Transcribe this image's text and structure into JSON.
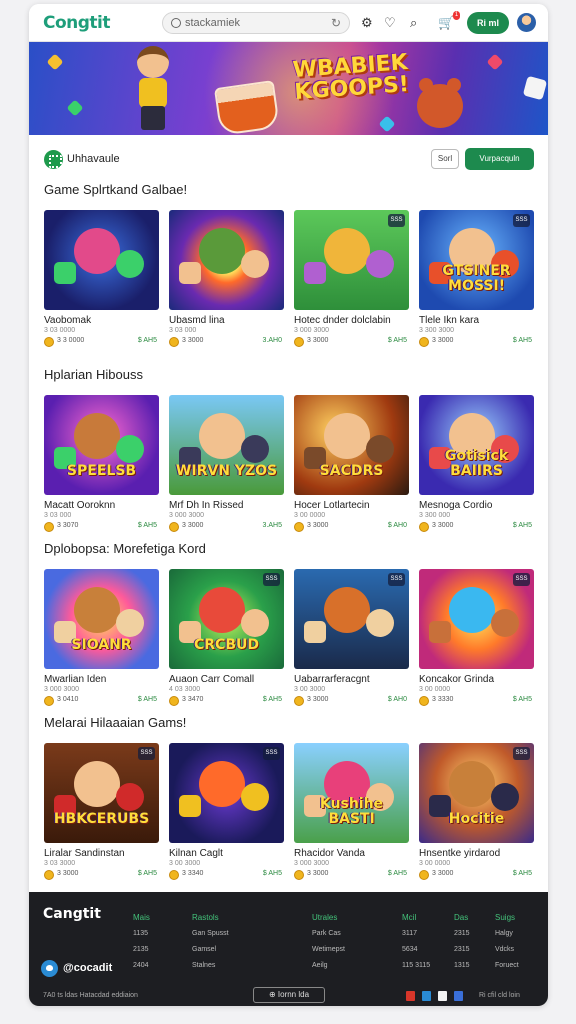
{
  "header": {
    "logo": "Congtit",
    "search_placeholder": "stackamiek",
    "cart_count": "1",
    "button_label": "Ri ml"
  },
  "banner": {
    "title": "WBABIEK KGOOPS!"
  },
  "category_bar": {
    "label": "Uhhavaule",
    "sort_label": "Sorl",
    "action_label": "Vurpacquln"
  },
  "sections": [
    {
      "title": "Game Splrtkand Galbae!",
      "cards": [
        {
          "name": "Vaobomak",
          "sub": "3 03 0000",
          "rating": "3 3 0000",
          "price": "$ AH5",
          "art_text": "",
          "badge": ""
        },
        {
          "name": "Ubasmd lina",
          "sub": "3 03 000",
          "rating": "3 3000",
          "price": "3.AH0",
          "art_text": "",
          "badge": ""
        },
        {
          "name": "Hotec dnder dolclabin",
          "sub": "3 000 3000",
          "rating": "3 3000",
          "price": "$ AH5",
          "art_text": "",
          "badge": "SSS"
        },
        {
          "name": "Tlele Ikn kara",
          "sub": "3 300 3000",
          "rating": "3 3000",
          "price": "$ AH5",
          "art_text": "GTSINER MOSSI!",
          "badge": "SSS"
        }
      ]
    },
    {
      "title": "Hplarian Hibouss",
      "cards": [
        {
          "name": "Macatt Ooroknn",
          "sub": "3 03 000",
          "rating": "3 3070",
          "price": "$ AH5",
          "art_text": "SPEELSB",
          "badge": ""
        },
        {
          "name": "Mrf Dh In Rissed",
          "sub": "3 000 3000",
          "rating": "3 3000",
          "price": "3.AH5",
          "art_text": "WIRVN YZOS",
          "badge": ""
        },
        {
          "name": "Hocer Lotlartecin",
          "sub": "3 00 0000",
          "rating": "3 3000",
          "price": "$ AH0",
          "art_text": "SACDRS",
          "badge": ""
        },
        {
          "name": "Mesnoga Cordio",
          "sub": "3 300 000",
          "rating": "3 3000",
          "price": "$ AH5",
          "art_text": "Gotisick BAIIRS",
          "badge": ""
        }
      ]
    },
    {
      "title": "Dplobopsa: Morefetiga Kord",
      "cards": [
        {
          "name": "Mwarlian Iden",
          "sub": "3 000 3000",
          "rating": "3 0410",
          "price": "$ AH5",
          "art_text": "SIOANR",
          "badge": ""
        },
        {
          "name": "Auaon Carr Comall",
          "sub": "4 03 3000",
          "rating": "3 3470",
          "price": "$ AH5",
          "art_text": "CRCBUD",
          "badge": "SSS"
        },
        {
          "name": "Uabarrarferacgnt",
          "sub": "3 00 3000",
          "rating": "3 3000",
          "price": "$ AH0",
          "art_text": "",
          "badge": "SSS"
        },
        {
          "name": "Koncakor Grinda",
          "sub": "3 00 0000",
          "rating": "3 3330",
          "price": "$ AH5",
          "art_text": "",
          "badge": "SSS"
        }
      ]
    },
    {
      "title": "Melarai Hilaaaian Gams!",
      "cards": [
        {
          "name": "Liralar Sandinstan",
          "sub": "3 03 3000",
          "rating": "3 3000",
          "price": "$ AH5",
          "art_text": "HBKCERUBS",
          "badge": "SSS"
        },
        {
          "name": "Kilnan Caglt",
          "sub": "3 00 3000",
          "rating": "3 3340",
          "price": "$ AH5",
          "art_text": "",
          "badge": "SSS"
        },
        {
          "name": "Rhacidor Vanda",
          "sub": "3 000 3000",
          "rating": "3 3000",
          "price": "$ AH5",
          "art_text": "Kushihe BASTI",
          "badge": ""
        },
        {
          "name": "Hnsentke yirdarod",
          "sub": "3 00 0000",
          "rating": "3 3000",
          "price": "$ AH5",
          "art_text": "Hocitie",
          "badge": "SSS"
        }
      ]
    }
  ],
  "footer": {
    "logo": "Cangtit",
    "handle": "@cocadit",
    "columns": [
      {
        "heading": "Mais",
        "items": [
          "1135",
          "2135",
          "2404"
        ]
      },
      {
        "heading": "Rastols",
        "items": [
          "Gan Spusst",
          "Gamsel",
          "Stalnes"
        ]
      },
      {
        "heading": "Utrales",
        "items": [
          "Park Cas",
          "Wetimepst",
          "Aeilg"
        ]
      },
      {
        "heading": "Mcil",
        "items": [
          "3117",
          "5634",
          "115 3115"
        ]
      },
      {
        "heading": "Das",
        "items": [
          "2315",
          "2315",
          "1315"
        ]
      },
      {
        "heading": "Suigs",
        "items": [
          "Halgy",
          "Vdcks",
          "Foruect"
        ]
      }
    ],
    "copyright": "7A0 ts ldas Hatacdad eddiaion",
    "language": "Iornn lda",
    "note": "Ri cfil cld loin"
  }
}
